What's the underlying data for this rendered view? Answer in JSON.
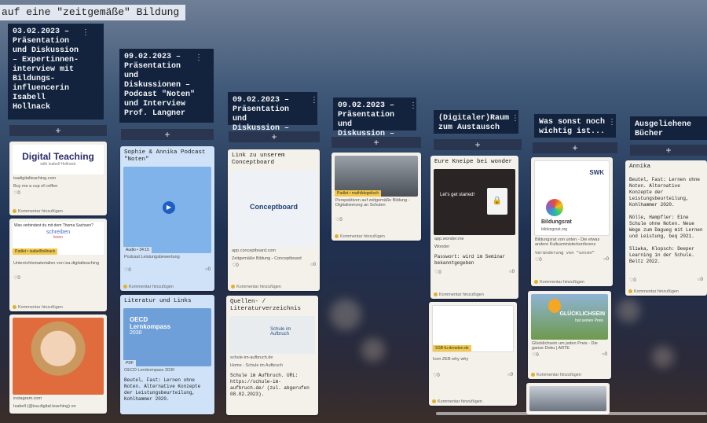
{
  "board": {
    "title": "auf eine \"zeitgemäße\" Bildung"
  },
  "add_label": "+",
  "menu_glyph": "⋮",
  "comment_label": "Kommentar hinzufügen",
  "columns": [
    {
      "title": "03.02.2023 –\nPräsentation\nund Diskussion\n– Expertinnen-\ninterview mit\nBildungs-\ninfluencerin\nIsabell\nHollnack"
    },
    {
      "title": "09.02.2023 –\nPräsentation\nund\nDiskussionen –\nPodcast \"Noten\"\nund Interview\nProf. Langner"
    },
    {
      "title": "09.02.2023 –\nPräsentation und\nDiskussion –"
    },
    {
      "title": "09.02.2023 –\nPräsentation und\nDiskussion –"
    },
    {
      "title": "(Digitaler)Raum\nzum Austausch"
    },
    {
      "title": "Was sonst noch\nwichtig ist..."
    },
    {
      "title": "Ausgeliehene\nBücher"
    }
  ],
  "cards": {
    "c1a": {
      "logo": "Digital Teaching",
      "sub": "with Isabell Hollnack",
      "url": "isadigitalteaching.com",
      "desc": "Buy me a cup of coffee",
      "likes": "0"
    },
    "c1b": {
      "q": "Was verbindest du mit dem Thema Sachsen?",
      "w1": "schreiben",
      "w2": "lesen",
      "badge": "Padlet • isabellhollnack",
      "desc": "Unterrichtsmaterialien von isa.digitalteaching",
      "likes": "0"
    },
    "c1c": {
      "url": "instagram.com",
      "desc": "Isabell (@isa.digital.teaching) on",
      "likes": "0"
    },
    "c2a": {
      "title": "Sophie & Annika Podcast \"Noten\"",
      "badge": "Audio • 34:15",
      "desc": "Podcast Leistungsbewertung",
      "likes": "0",
      "replies": "0"
    },
    "c2b": {
      "title": "Literatur und Links",
      "book1": "OECD",
      "book2": "Lernkompass",
      "book3": "2030",
      "badge": "PDF",
      "desc": "OECD Lernkompass 2030",
      "text": "Beutel, Fast: Lernen ohne Noten. Alternative Konzepte der Leistungsbeurteilung, Kohlhammer 2020."
    },
    "c3a": {
      "title": "Link zu unserem Conceptboard",
      "logo": "Conceptboard",
      "url": "app.conceptboard.com",
      "desc": "Zeitgemäße Bildung - Conceptboard",
      "likes": "0",
      "replies": "0"
    },
    "c3b": {
      "title": "Quellen- / Literaturverzeichnis",
      "logo": "Schule im Aufbruch",
      "url": "schule-im-aufbruch.de",
      "desc": "Home - Schule im Aufbruch",
      "text": "Schule im Aufbruch. URL: https://schule-im-aufbruch.de/ (zul. abgerufen 08.02.2023)."
    },
    "c4a": {
      "badge": "Padlet • mathildegelisch",
      "desc": "Perspektiven auf zeitgemäße Bildung - Digitalisierung an Schulen",
      "likes": "0"
    },
    "c5a": {
      "title": "Eure Kneipe bei wonder",
      "img": "Let's get started!",
      "url": "app.wonder.me",
      "desc": "Wonder",
      "text": "Passwort: wird im Seminar bekanntgegeben",
      "likes": "0",
      "replies": "0"
    },
    "c5b": {
      "badge": "SSB-fu-dresden.de",
      "desc": "Icon ZEB why why",
      "likes": "0",
      "replies": "0"
    },
    "c6a": {
      "logo": "Bildungsrat",
      "url": "bildungsrat.org",
      "badge": "SWK",
      "desc": "Bildungsrat von unten - Die etwas andere Kultusministerkonferenz",
      "text": "Veränderung von \"unten\"",
      "likes": "0",
      "replies": "0"
    },
    "c6b": {
      "img": "GLÜCKLICHSEIN",
      "img2": "hat seinen Preis",
      "desc": "Glücklichsein um jeden Preis - Die ganze Doku | ARTE",
      "likes": "0",
      "replies": "0"
    },
    "c7a": {
      "title": "Annika",
      "text": "Beutel, Fast: Lernen ohne Noten. Alternative Konzepte der Leistungsbeurteilung, Kohlhammer 2020.\n\nNölle, Hampfler: Eine Schule ohne Noten. Neue Wege zum Dagueg mit Lernen und Leistung, beq 2021.\n\nSliwka, Klopsch: Deeper Learning in der Schule. Beltz 2022.",
      "likes": "0",
      "replies": "0"
    }
  },
  "colors": {
    "header": "#13233d",
    "card": "#f4f1ea",
    "blue_card": "#cfe2f7",
    "accent": "#f2c94c"
  }
}
